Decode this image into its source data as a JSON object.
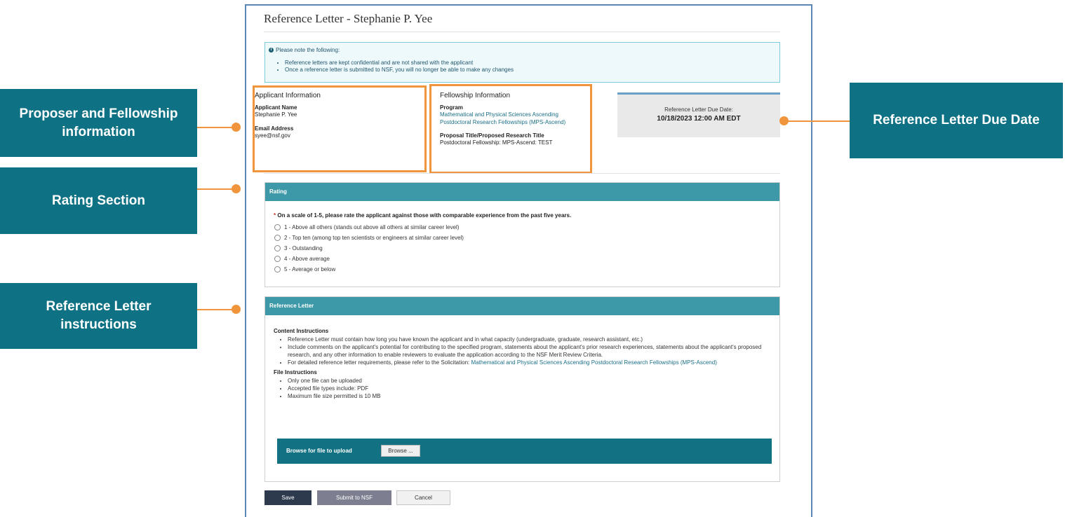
{
  "page": {
    "title": "Reference Letter - Stephanie P. Yee"
  },
  "notice": {
    "heading": "Please note the following:",
    "icon": "info-icon",
    "items": [
      "Reference letters are kept confidential and are not shared with the applicant",
      "Once a reference letter is submitted to NSF, you will no longer be able to make any changes"
    ]
  },
  "applicant": {
    "section_title": "Applicant Information",
    "name_label": "Applicant Name",
    "name": "Stephanie P. Yee",
    "email_label": "Email Address",
    "email": "syee@nsf.gov"
  },
  "fellowship": {
    "section_title": "Fellowship Information",
    "program_label": "Program",
    "program_line1": "Mathematical and Physical Sciences Ascending",
    "program_line2": "Postdoctoral Research Fellowships (MPS-Ascend)",
    "proposal_label": "Proposal Title/Proposed Research Title",
    "proposal_title": "Postdoctoral Fellowship: MPS-Ascend: TEST"
  },
  "due": {
    "label": "Reference Letter Due Date:",
    "value": "10/18/2023 12:00 AM EDT"
  },
  "rating": {
    "header": "Rating",
    "required_marker": "*",
    "question": "On a scale of 1-5, please rate the applicant against those with comparable experience from the past five years.",
    "options": [
      "1 - Above all others (stands out above all others at similar career level)",
      "2 - Top ten (among top ten scientists or engineers at similar career level)",
      "3 - Outstanding",
      "4 - Above average",
      "5 - Average or below"
    ]
  },
  "reference": {
    "header": "Reference Letter",
    "content_title": "Content Instructions",
    "content_items": [
      "Reference Letter must contain how long you have known the applicant and in what capacity (undergraduate, graduate, research assistant, etc.)",
      "Include comments on the applicant's potential for contributing to the specified program, statements about the applicant's prior research experiences, statements about the applicant's proposed research, and any other information to enable reviewers to evaluate the application according to the NSF Merit Review Criteria."
    ],
    "solicitation_prefix": "For detailed reference letter requirements, please refer to the Solicitation:",
    "solicitation_link": "Mathematical and Physical Sciences Ascending Postdoctoral Research Fellowships (MPS-Ascend)",
    "file_title": "File Instructions",
    "file_items": [
      "Only one file can be uploaded",
      "Accepted file types include: PDF",
      "Maximum file size permitted is 10 MB"
    ],
    "upload_label": "Browse for file to upload",
    "browse_label": "Browse ..."
  },
  "actions": {
    "save": "Save",
    "submit": "Submit to NSF",
    "cancel": "Cancel"
  },
  "callouts": {
    "proposer": "Proposer and Fellowship information",
    "rating": "Rating Section",
    "reference": "Reference Letter instructions",
    "due": "Reference Letter Due Date"
  },
  "colors": {
    "accent_teal": "#0f7284",
    "header_teal": "#3d98a8",
    "highlight_orange": "#f0953b",
    "link": "#1c6f87"
  }
}
